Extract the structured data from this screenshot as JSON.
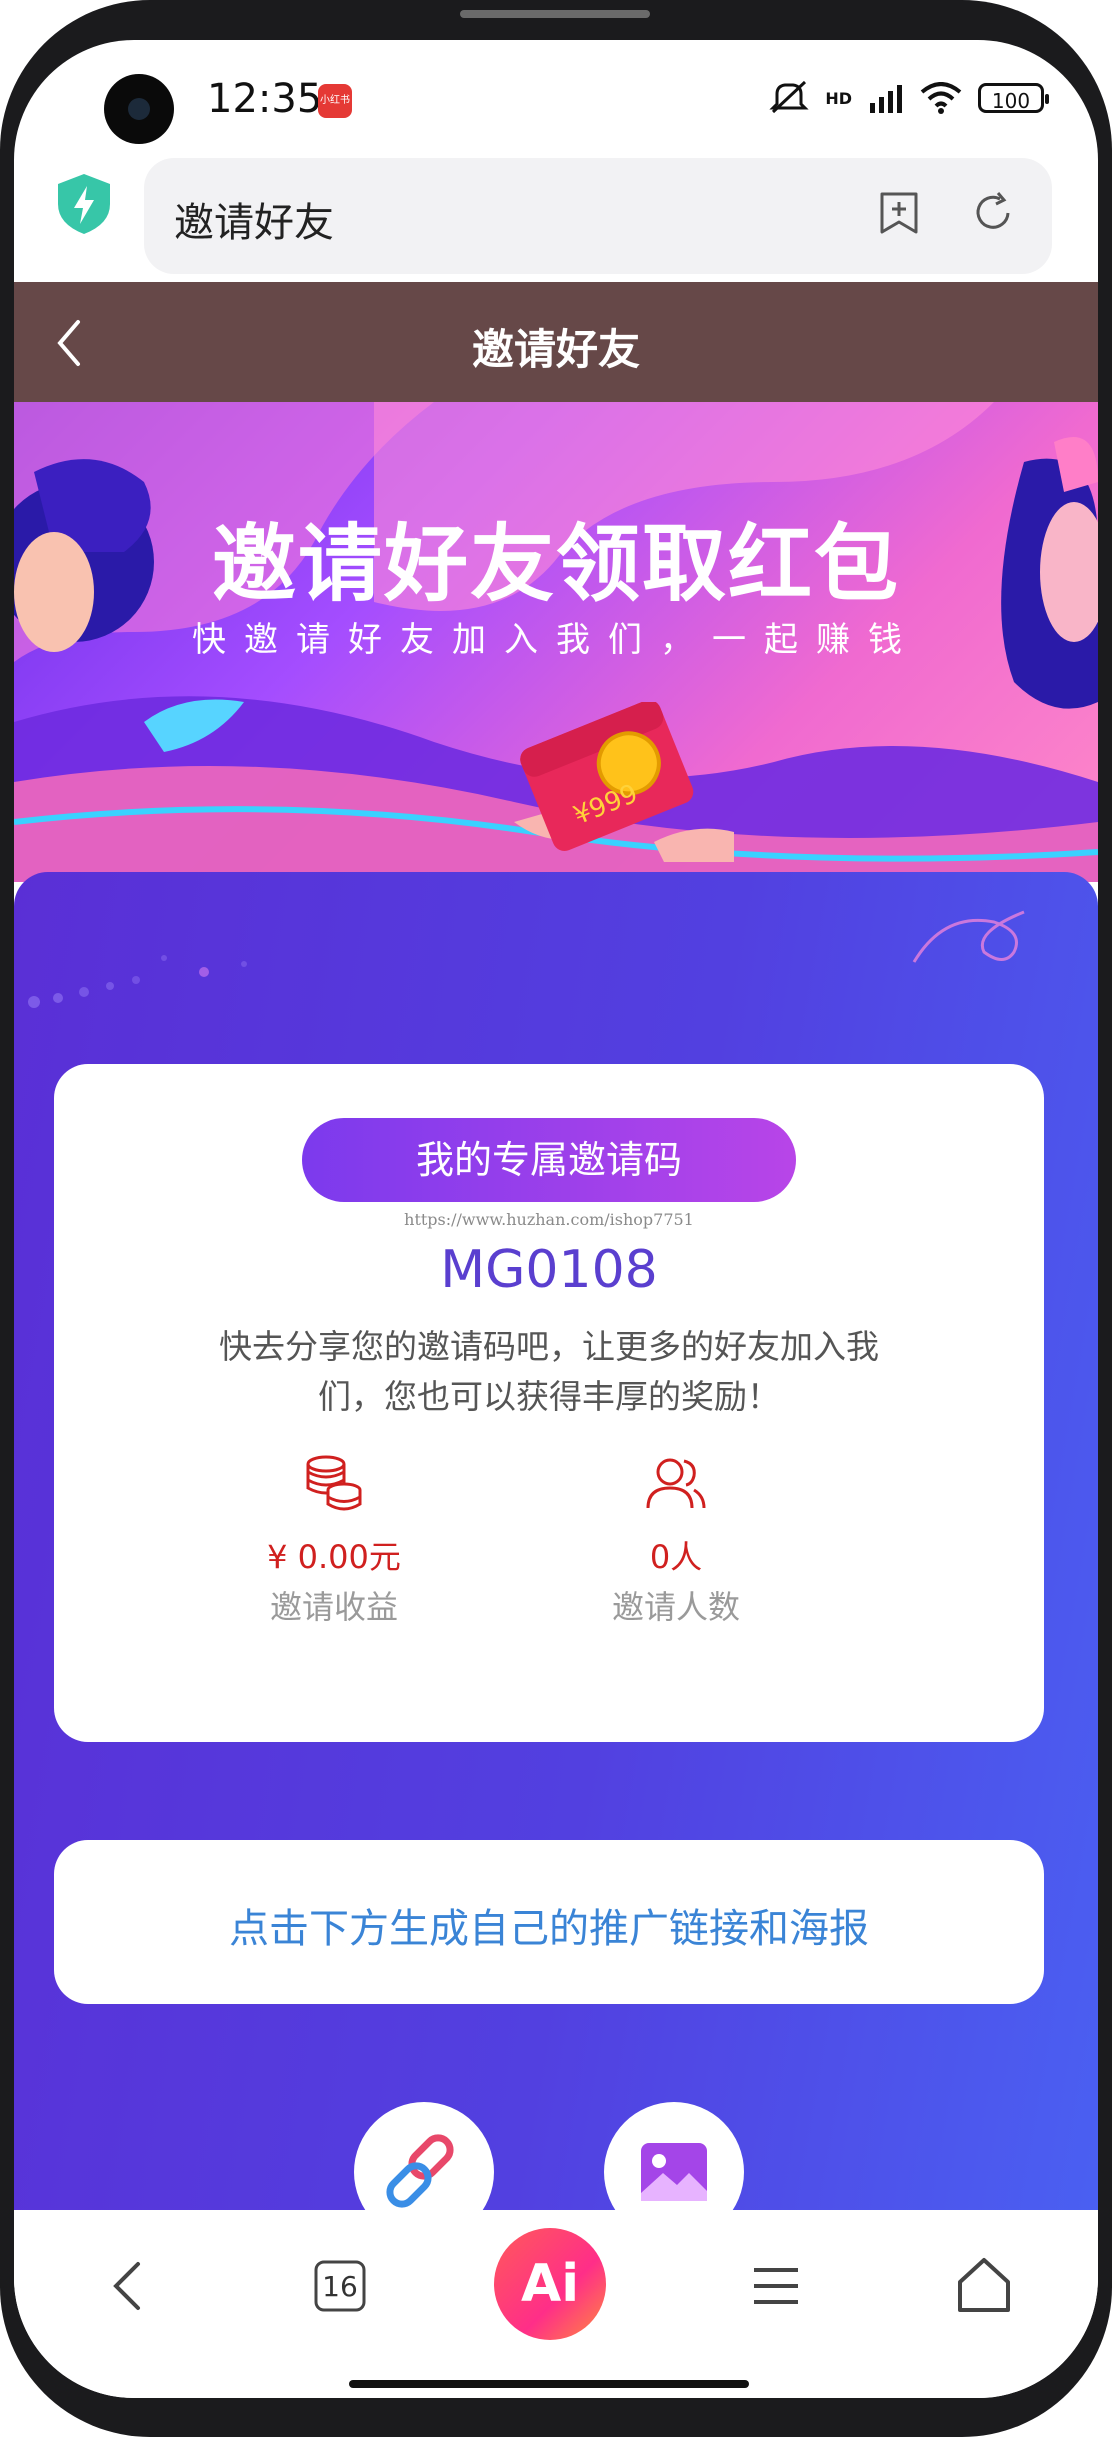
{
  "status_bar": {
    "time": "12:35",
    "app_badge": "小红书",
    "battery": "100",
    "network": "HD"
  },
  "browser": {
    "url_text": "邀请好友",
    "tabs_count": "16",
    "ai_label": "Ai"
  },
  "header": {
    "title": "邀请好友"
  },
  "banner": {
    "title": "邀请好友领取红包",
    "subtitle": "快邀请好友加入我们，一起赚钱",
    "envelope_amount": "¥999"
  },
  "invite_card": {
    "pill_label": "我的专属邀请码",
    "watermark": "https://www.huzhan.com/ishop7751",
    "code": "MG0108",
    "description": "快去分享您的邀请码吧，让更多的好友加入我们，您也可以获得丰厚的奖励！",
    "stats": [
      {
        "icon": "coins-icon",
        "value": "¥ 0.00元",
        "label": "邀请收益"
      },
      {
        "icon": "users-icon",
        "value": "0人",
        "label": "邀请人数"
      }
    ]
  },
  "promo_card": {
    "text": "点击下方生成自己的推广链接和海报"
  },
  "colors": {
    "header_bg": "#664848",
    "main_gradient_start": "#5a2fd6",
    "main_gradient_end": "#4a60f2",
    "accent_red": "#d0201f",
    "link_blue": "#3a84d6"
  }
}
